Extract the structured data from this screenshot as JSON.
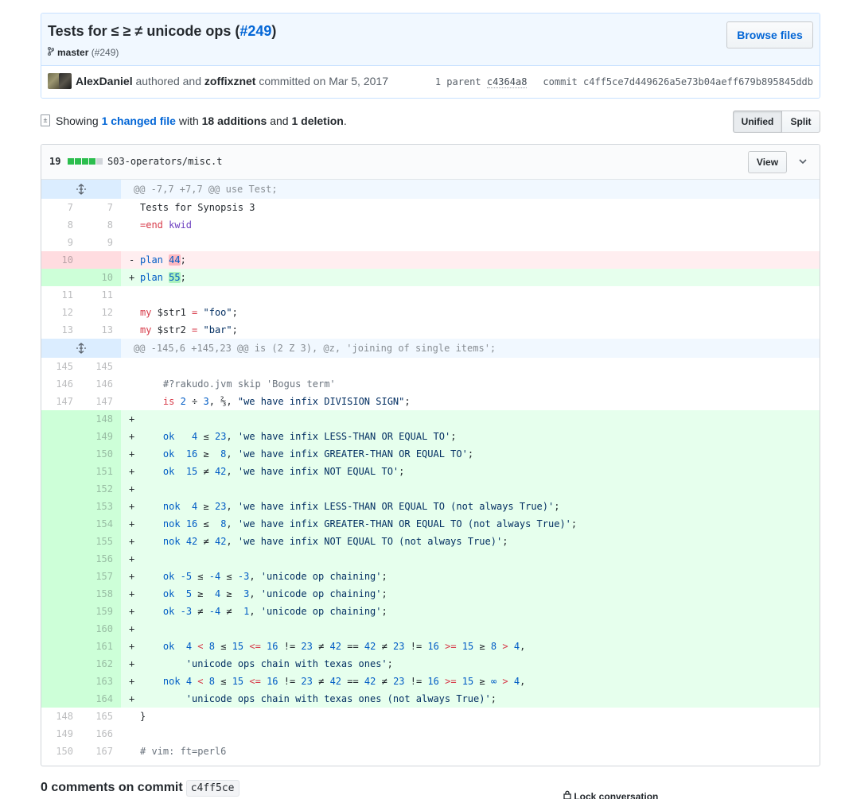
{
  "commit": {
    "title_prefix": "Tests for ≤ ≥ ≠ unicode ops (",
    "pr_link": "#249",
    "title_suffix": ")",
    "branch": "master",
    "branch_pr": "(#249)",
    "browse_label": "Browse files",
    "author": "AlexDaniel",
    "authored_text": " authored and ",
    "committer": "zoffixznet",
    "committed_text": " committed on Mar 5, 2017",
    "parent_label": "1 parent",
    "parent_sha": "c4364a8",
    "commit_label": "commit",
    "commit_sha": "c4ff5ce7d449626a5e73b04aeff679b895845ddb"
  },
  "summary": {
    "showing": "Showing ",
    "changed_files": "1 changed file",
    "with": " with ",
    "additions": "18 additions",
    "and": " and ",
    "deletions": "1 deletion",
    "end": ".",
    "unified_label": "Unified",
    "split_label": "Split"
  },
  "file": {
    "change_count": "19",
    "path": "S03-operators/misc.t",
    "view_label": "View",
    "diffstat": {
      "additions": 4,
      "deletions": 0,
      "total_blocks": 5
    }
  },
  "hunk1": "@@ -7,7 +7,7 @@ use Test;",
  "hunk2": "@@ -145,6 +145,23 @@ is (2 Z 3), @z, 'joining of single items';",
  "lines": {
    "l7": {
      "old": "7",
      "new": "7",
      "text": "Tests for Synopsis 3"
    },
    "l8": {
      "old": "8",
      "new": "8",
      "kw": "=end",
      "rest": " kwid"
    },
    "l9": {
      "old": "9",
      "new": "9"
    },
    "d10": {
      "old": "10",
      "kw": "plan",
      "sp": " ",
      "num": "44",
      "end": ";"
    },
    "a10": {
      "new": "10",
      "kw": "plan",
      "sp": " ",
      "num": "55",
      "end": ";"
    },
    "l11": {
      "old": "11",
      "new": "11"
    },
    "l12": {
      "old": "12",
      "new": "12",
      "kw": "my",
      "var": " $str1 ",
      "op": "=",
      "str": " \"foo\"",
      "end": ";"
    },
    "l13": {
      "old": "13",
      "new": "13",
      "kw": "my",
      "var": " $str2 ",
      "op": "=",
      "str": " \"bar\"",
      "end": ";"
    },
    "l145": {
      "old": "145",
      "new": "145"
    },
    "l146": {
      "old": "146",
      "new": "146",
      "text": "    #?rakudo.jvm skip 'Bogus term'"
    },
    "l147": {
      "old": "147",
      "new": "147",
      "kw": "is",
      "a": " 2",
      "op": " ÷ ",
      "b": "3",
      "rest": ", ⅔, ",
      "str": "\"we have infix DIVISION SIGN\"",
      "end": ";"
    },
    "l148": {
      "new": "148"
    },
    "l149": {
      "new": "149",
      "code": "    ok   4 ≤ 23, 'we have infix LESS-THAN OR EQUAL TO';"
    },
    "l150": {
      "new": "150",
      "code": "    ok  16 ≥  8, 'we have infix GREATER-THAN OR EQUAL TO';"
    },
    "l151": {
      "new": "151",
      "code": "    ok  15 ≠ 42, 'we have infix NOT EQUAL TO';"
    },
    "l152": {
      "new": "152"
    },
    "l153": {
      "new": "153",
      "code": "    nok  4 ≥ 23, 'we have infix LESS-THAN OR EQUAL TO (not always True)';"
    },
    "l154": {
      "new": "154",
      "code": "    nok 16 ≤  8, 'we have infix GREATER-THAN OR EQUAL TO (not always True)';"
    },
    "l155": {
      "new": "155",
      "code": "    nok 42 ≠ 42, 'we have infix NOT EQUAL TO (not always True)';"
    },
    "l156": {
      "new": "156"
    },
    "l157": {
      "new": "157",
      "code": "    ok -5 ≤ -4 ≤ -3, 'unicode op chaining';"
    },
    "l158": {
      "new": "158",
      "code": "    ok  5 ≥  4 ≥  3, 'unicode op chaining';"
    },
    "l159": {
      "new": "159",
      "code": "    ok -3 ≠ -4 ≠  1, 'unicode op chaining';"
    },
    "l160": {
      "new": "160"
    },
    "l161": {
      "new": "161",
      "code": "    ok  4 < 8 ≤ 15 <= 16 != 23 ≠ 42 == 42 ≠ 23 != 16 >= 15 ≥ 8 > 4,"
    },
    "l162": {
      "new": "162",
      "code": "        'unicode ops chain with texas ones';"
    },
    "l163": {
      "new": "163",
      "code": "    nok 4 < 8 ≤ 15 <= 16 != 23 ≠ 42 == 42 ≠ 23 != 16 >= 15 ≥ ∞ > 4,"
    },
    "l164": {
      "new": "164",
      "code": "        'unicode ops chain with texas ones (not always True)';"
    },
    "l165": {
      "old": "148",
      "new": "165",
      "text": "}"
    },
    "l166": {
      "old": "149",
      "new": "166"
    },
    "l167": {
      "old": "150",
      "new": "167",
      "text": "# vim: ft=perl6"
    }
  },
  "comments": {
    "title": "0 comments on commit",
    "sha": "c4ff5ce",
    "lock_label": "Lock conversation"
  },
  "colors": {
    "accent": "#0366d6",
    "add_bg": "#e6ffed",
    "del_bg": "#ffeef0",
    "hunk_bg": "#f1f8ff"
  },
  "icons": [
    "branch-icon",
    "file-diff-icon",
    "unfold-icon",
    "chevron-down-icon",
    "lock-icon"
  ]
}
